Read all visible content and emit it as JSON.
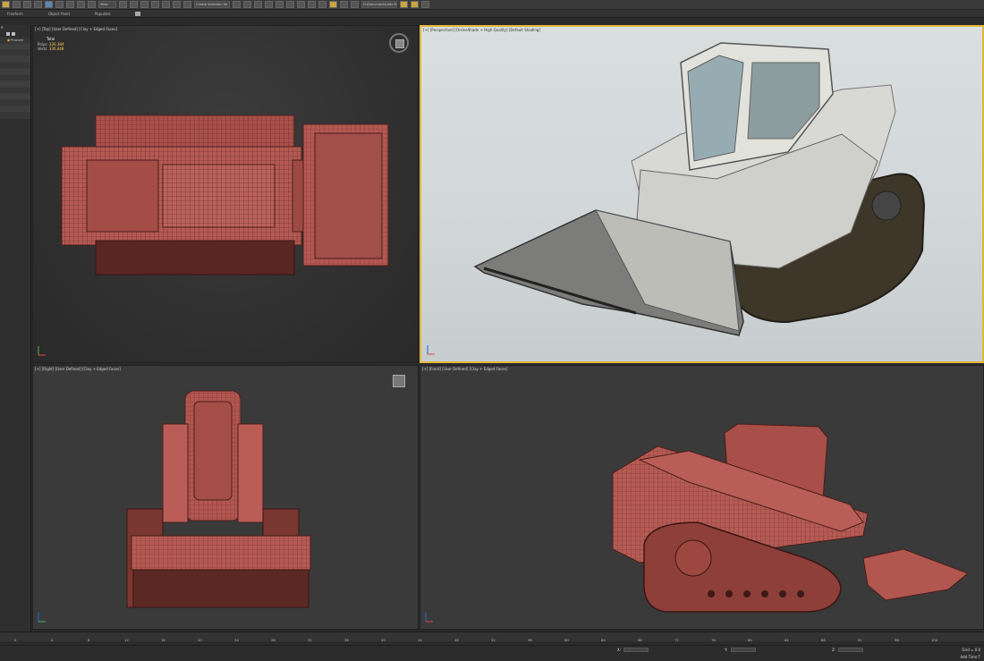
{
  "toolbar": {
    "view_dropdown": "View",
    "selection_set_dropdown": "Create Selection Se",
    "path_dropdown": "D:\\Documents\\3ds Max 2020"
  },
  "ribbon": {
    "tabs": [
      "Freeform",
      "Object Paint",
      "Populate"
    ]
  },
  "scene_explorer": {
    "header": "e",
    "rows": [
      "Proxiver",
      "",
      "",
      "",
      "",
      "",
      "",
      "",
      "",
      "",
      "",
      "",
      "",
      ""
    ]
  },
  "viewports": {
    "top": {
      "label": "[+] [Top] [User Defined] [Clay + Edged Faces]"
    },
    "perspective": {
      "label": "[+] [Perspective] [OnlineShade + High Quality] [Default Shading]"
    },
    "right": {
      "label": "[+] [Right] [User Defined] [Clay + Edged Faces]"
    },
    "front": {
      "label": "[+] [Front] [User Defined] [Clay + Edged Faces]"
    }
  },
  "stats": {
    "header": "Total",
    "polys_label": "Polys:",
    "polys_value": "326,384",
    "verts_label": "Verts:",
    "verts_value": "330,448"
  },
  "timeline": {
    "ticks": [
      "0",
      "4",
      "8",
      "12",
      "16",
      "20",
      "24",
      "28",
      "32",
      "36",
      "40",
      "44",
      "48",
      "52",
      "56",
      "60",
      "64",
      "68",
      "72",
      "76",
      "80",
      "84",
      "88",
      "92",
      "96",
      "100"
    ]
  },
  "status": {
    "x_label": "X:",
    "y_label": "Y:",
    "z_label": "Z:",
    "grid": "Grid = 0.0",
    "add_time_tag": "Add Time T"
  },
  "colors": {
    "active_border": "#e2b63a",
    "model_red": "#b5554c",
    "viewport_bg": "#3a3a3a",
    "perspective_bg": "#d5dadb"
  }
}
